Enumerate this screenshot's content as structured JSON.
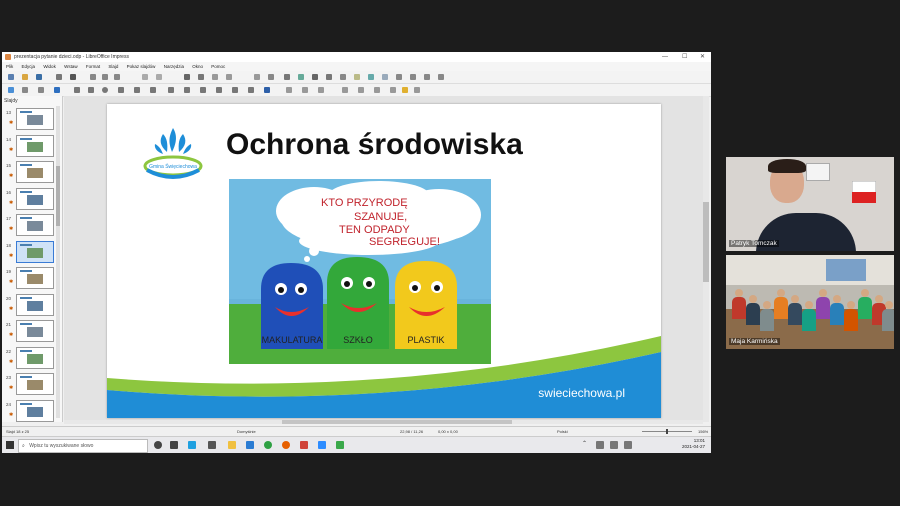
{
  "window": {
    "title": "prezentacja pytanie dzieci.odp - LibreOffice Impress",
    "controls": {
      "minimize": "—",
      "maximize": "☐",
      "close": "✕"
    }
  },
  "menu": [
    "Plik",
    "Edycja",
    "Widok",
    "Wstaw",
    "Format",
    "Slajd",
    "Pokaz slajdów",
    "Narzędzia",
    "Okno",
    "Pomoc"
  ],
  "sidebar": {
    "header": "Slajdy",
    "slides": [
      {
        "number": "13"
      },
      {
        "number": "14"
      },
      {
        "number": "15"
      },
      {
        "number": "16"
      },
      {
        "number": "17"
      },
      {
        "number": "18"
      },
      {
        "number": "19"
      },
      {
        "number": "20"
      },
      {
        "number": "21"
      },
      {
        "number": "22"
      },
      {
        "number": "23"
      },
      {
        "number": "24"
      }
    ],
    "selected_number": "18"
  },
  "slide": {
    "logo_text": "Gmina Święciechowa",
    "title": "Ochrona środowiska",
    "painting": {
      "cloud_lines": [
        "KTO PRZYRODĘ",
        "SZANUJE,",
        "TEN ODPADY",
        "SEGREGUJE!"
      ],
      "bin_labels": [
        "MAKULATURA",
        "SZKŁO",
        "PLASTIK"
      ]
    },
    "url": "swieciechowa.pl"
  },
  "statusbar": {
    "slide_info": "Slajd 18 z 25",
    "layout": "Domyślnie",
    "position": "22,98 / 11,26",
    "size": "0,00 x 0,00",
    "language": "Polski",
    "zoom": "156%"
  },
  "taskbar": {
    "search_placeholder": "Wpisz tu wyszukiwane słowo",
    "time": "13:01",
    "date": "2021-04-27"
  },
  "participants": [
    {
      "name": "Patryk Tomczak"
    },
    {
      "name": "Maja Karmińska"
    }
  ],
  "colors": {
    "accent": "#1f8dd6",
    "green": "#8dc63f",
    "bg": "#1c1c1c"
  }
}
